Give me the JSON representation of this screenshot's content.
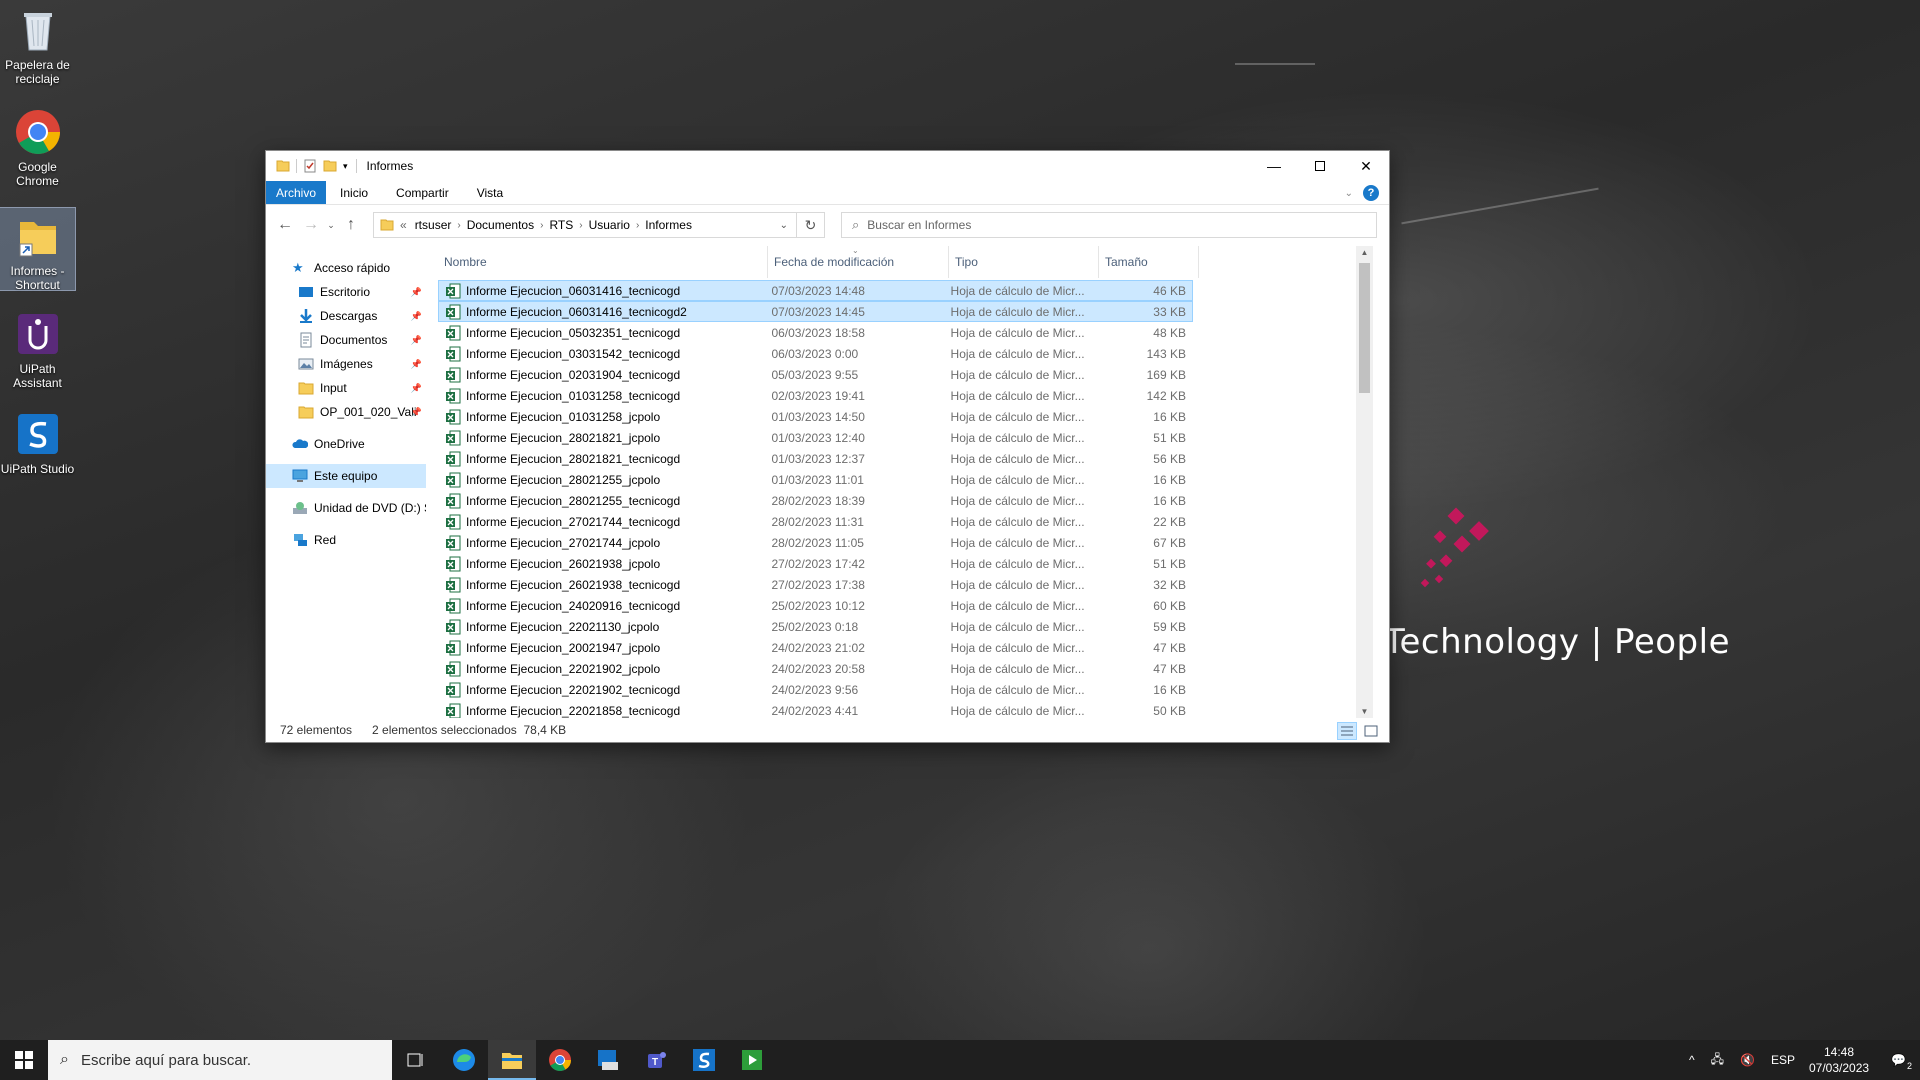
{
  "desktop": {
    "icons": [
      {
        "label": "Papelera de reciclaje"
      },
      {
        "label": "Google Chrome"
      },
      {
        "label": "Informes - Shortcut"
      },
      {
        "label": "UiPath Assistant"
      },
      {
        "label": "UiPath Studio"
      }
    ],
    "wallpaper_text": "Technology | People",
    "brand_color": "#c2185b"
  },
  "window": {
    "title": "Informes",
    "ribbon_tabs": [
      "Archivo",
      "Inicio",
      "Compartir",
      "Vista"
    ],
    "breadcrumbs": [
      "rtsuser",
      "Documentos",
      "RTS",
      "Usuario",
      "Informes"
    ],
    "breadcrumb_prefix": "«",
    "search_placeholder": "Buscar en Informes",
    "help_label": "?",
    "nav": {
      "quick_access": "Acceso rápido",
      "items": [
        {
          "label": "Escritorio",
          "icon": "desktop-icon"
        },
        {
          "label": "Descargas",
          "icon": "download-icon"
        },
        {
          "label": "Documentos",
          "icon": "documents-icon"
        },
        {
          "label": "Imágenes",
          "icon": "pictures-icon"
        },
        {
          "label": "Input",
          "icon": "folder-icon"
        },
        {
          "label": "OP_001_020_Vali",
          "icon": "folder-icon"
        }
      ],
      "onedrive": "OneDrive",
      "this_pc": "Este equipo",
      "dvd": "Unidad de DVD (D:) S",
      "network": "Red"
    },
    "columns": {
      "name": "Nombre",
      "date": "Fecha de modificación",
      "type": "Tipo",
      "size": "Tamaño"
    },
    "files": [
      {
        "name": "Informe Ejecucion_06031416_tecnicogd",
        "date": "07/03/2023 14:48",
        "type": "Hoja de cálculo de Micr...",
        "size": "46 KB",
        "selected": true
      },
      {
        "name": "Informe Ejecucion_06031416_tecnicogd2",
        "date": "07/03/2023 14:45",
        "type": "Hoja de cálculo de Micr...",
        "size": "33 KB",
        "selected": true
      },
      {
        "name": "Informe Ejecucion_05032351_tecnicogd",
        "date": "06/03/2023 18:58",
        "type": "Hoja de cálculo de Micr...",
        "size": "48 KB"
      },
      {
        "name": "Informe Ejecucion_03031542_tecnicogd",
        "date": "06/03/2023 0:00",
        "type": "Hoja de cálculo de Micr...",
        "size": "143 KB"
      },
      {
        "name": "Informe Ejecucion_02031904_tecnicogd",
        "date": "05/03/2023 9:55",
        "type": "Hoja de cálculo de Micr...",
        "size": "169 KB"
      },
      {
        "name": "Informe Ejecucion_01031258_tecnicogd",
        "date": "02/03/2023 19:41",
        "type": "Hoja de cálculo de Micr...",
        "size": "142 KB"
      },
      {
        "name": "Informe Ejecucion_01031258_jcpolo",
        "date": "01/03/2023 14:50",
        "type": "Hoja de cálculo de Micr...",
        "size": "16 KB"
      },
      {
        "name": "Informe Ejecucion_28021821_jcpolo",
        "date": "01/03/2023 12:40",
        "type": "Hoja de cálculo de Micr...",
        "size": "51 KB"
      },
      {
        "name": "Informe Ejecucion_28021821_tecnicogd",
        "date": "01/03/2023 12:37",
        "type": "Hoja de cálculo de Micr...",
        "size": "56 KB"
      },
      {
        "name": "Informe Ejecucion_28021255_jcpolo",
        "date": "01/03/2023 11:01",
        "type": "Hoja de cálculo de Micr...",
        "size": "16 KB"
      },
      {
        "name": "Informe Ejecucion_28021255_tecnicogd",
        "date": "28/02/2023 18:39",
        "type": "Hoja de cálculo de Micr...",
        "size": "16 KB"
      },
      {
        "name": "Informe Ejecucion_27021744_tecnicogd",
        "date": "28/02/2023 11:31",
        "type": "Hoja de cálculo de Micr...",
        "size": "22 KB"
      },
      {
        "name": "Informe Ejecucion_27021744_jcpolo",
        "date": "28/02/2023 11:05",
        "type": "Hoja de cálculo de Micr...",
        "size": "67 KB"
      },
      {
        "name": "Informe Ejecucion_26021938_jcpolo",
        "date": "27/02/2023 17:42",
        "type": "Hoja de cálculo de Micr...",
        "size": "51 KB"
      },
      {
        "name": "Informe Ejecucion_26021938_tecnicogd",
        "date": "27/02/2023 17:38",
        "type": "Hoja de cálculo de Micr...",
        "size": "32 KB"
      },
      {
        "name": "Informe Ejecucion_24020916_tecnicogd",
        "date": "25/02/2023 10:12",
        "type": "Hoja de cálculo de Micr...",
        "size": "60 KB"
      },
      {
        "name": "Informe Ejecucion_22021130_jcpolo",
        "date": "25/02/2023 0:18",
        "type": "Hoja de cálculo de Micr...",
        "size": "59 KB"
      },
      {
        "name": "Informe Ejecucion_20021947_jcpolo",
        "date": "24/02/2023 21:02",
        "type": "Hoja de cálculo de Micr...",
        "size": "47 KB"
      },
      {
        "name": "Informe Ejecucion_22021902_jcpolo",
        "date": "24/02/2023 20:58",
        "type": "Hoja de cálculo de Micr...",
        "size": "47 KB"
      },
      {
        "name": "Informe Ejecucion_22021902_tecnicogd",
        "date": "24/02/2023 9:56",
        "type": "Hoja de cálculo de Micr...",
        "size": "16 KB"
      },
      {
        "name": "Informe Ejecucion_22021858_tecnicogd",
        "date": "24/02/2023 4:41",
        "type": "Hoja de cálculo de Micr...",
        "size": "50 KB"
      }
    ],
    "status": {
      "count": "72 elementos",
      "selection": "2 elementos seleccionados  78,4 KB"
    }
  },
  "taskbar": {
    "search_placeholder": "Escribe aquí para buscar.",
    "apps": [
      "task-view",
      "edge",
      "file-explorer",
      "chrome",
      "uipath-studio-orange",
      "teams",
      "uipath-studio",
      "uipath-player"
    ],
    "language": "ESP",
    "time": "14:48",
    "date": "07/03/2023",
    "notification_count": "2"
  }
}
